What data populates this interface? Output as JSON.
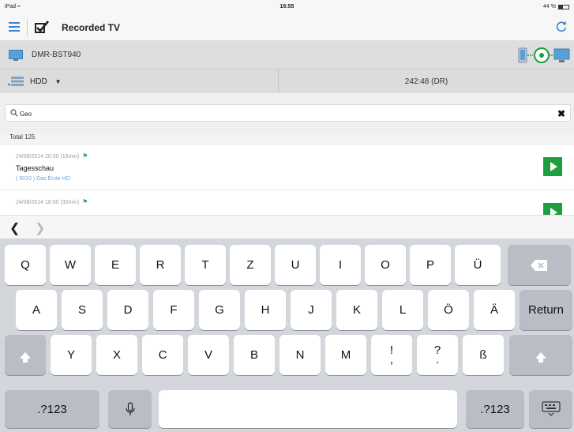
{
  "status_bar": {
    "device": "iPad",
    "time": "16:55",
    "battery": "44 %",
    "battery_level": 0.44
  },
  "nav": {
    "title": "Recorded TV"
  },
  "device": {
    "name": "DMR-BST940"
  },
  "storage": {
    "drive": "HDD",
    "remaining": "242:48 (DR)"
  },
  "search": {
    "value": "Geo"
  },
  "total": "Total 125",
  "recordings": [
    {
      "date": "24/08/2014 20:00 (15min)",
      "title": "Tagesschau",
      "channel": "( 0010 ) Das Erste HD"
    },
    {
      "date": "24/08/2014 18:50 (30min)",
      "title": "",
      "channel": ""
    }
  ],
  "keyboard": {
    "row1": [
      "Q",
      "W",
      "E",
      "R",
      "T",
      "Z",
      "U",
      "I",
      "O",
      "P",
      "Ü"
    ],
    "row2": [
      "A",
      "S",
      "D",
      "F",
      "G",
      "H",
      "J",
      "K",
      "L",
      "Ö",
      "Ä"
    ],
    "row3": [
      "Y",
      "X",
      "C",
      "V",
      "B",
      "N",
      "M"
    ],
    "punct1": [
      "!",
      ","
    ],
    "punct2": [
      "?",
      "."
    ],
    "sharp_s": "ß",
    "return_label": "Return",
    "numbers_label": ".?123"
  },
  "colors": {
    "accent": "#3a82d6",
    "play": "#1e9e3e",
    "flag": "#2a9ea6"
  },
  "icons": [
    "menu-icon",
    "checkbox-icon",
    "refresh-icon",
    "tv-icon",
    "cast-icon",
    "hdd-icon",
    "search-icon",
    "clear-icon",
    "flag-icon",
    "play-icon",
    "backspace-icon",
    "shift-icon",
    "mic-icon",
    "keyboard-dismiss-icon"
  ]
}
